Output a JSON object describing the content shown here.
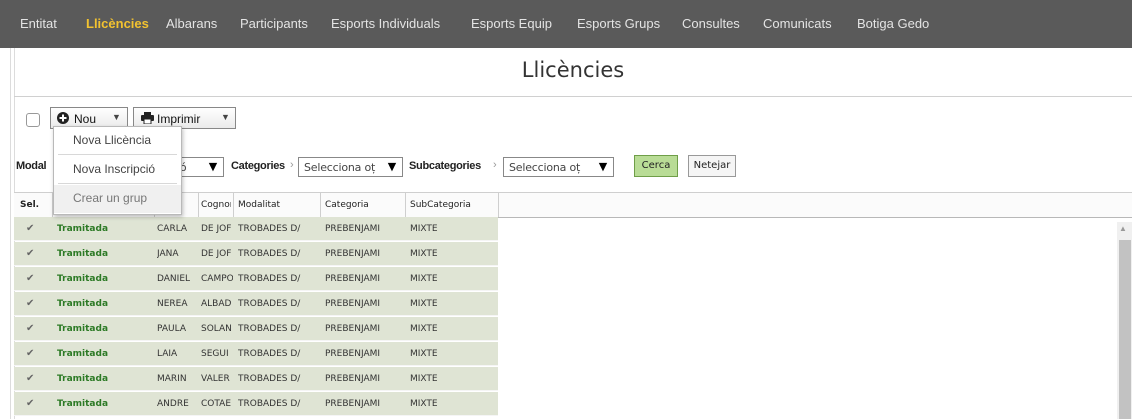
{
  "nav": {
    "items": [
      {
        "label": "Entitat",
        "active": false
      },
      {
        "label": "Llicències",
        "active": true
      },
      {
        "label": "Albarans",
        "active": false
      },
      {
        "label": "Participants",
        "active": false
      },
      {
        "label": "Esports Individuals",
        "active": false
      },
      {
        "label": "Esports Equip",
        "active": false
      },
      {
        "label": "Esports Grups",
        "active": false
      },
      {
        "label": "Consultes",
        "active": false
      },
      {
        "label": "Comunicats",
        "active": false
      },
      {
        "label": "Botiga Gedo",
        "active": false
      }
    ]
  },
  "page": {
    "title": "Llicències"
  },
  "toolbar": {
    "nou_label": "Nou",
    "imprimir_label": "Imprimir",
    "nou_icon": "plus-circle-icon",
    "imprimir_icon": "printer-icon"
  },
  "dropdown": {
    "items": [
      "Nova Llicència",
      "Nova Inscripció",
      "Crear un grup"
    ]
  },
  "filters": {
    "modalitat_label": "Modal",
    "modalitat_value": "ió",
    "categories_label": "Categories",
    "categories_value": "Selecciona oț",
    "subcategories_label": "Subcategories",
    "subcategories_value": "Selecciona oț",
    "search_button": "Cerca",
    "clear_button": "Netejar"
  },
  "grid": {
    "columns": [
      "Sel.",
      "",
      "",
      "Cognor",
      "Modalitat",
      "Categoria",
      "SubCategoria"
    ],
    "rows": [
      {
        "checked": true,
        "status": "Tramitada",
        "name": "CARLA",
        "surname": "DE JOF",
        "modalitat": "TROBADES D/",
        "categoria": "PREBENJAMÍ",
        "subcategoria": "MIXTE"
      },
      {
        "checked": true,
        "status": "Tramitada",
        "name": "JANA",
        "surname": "DE JOF",
        "modalitat": "TROBADES D/",
        "categoria": "PREBENJAMÍ",
        "subcategoria": "MIXTE"
      },
      {
        "checked": true,
        "status": "Tramitada",
        "name": "DANIEL",
        "surname": "CAMPO",
        "modalitat": "TROBADES D/",
        "categoria": "PREBENJAMÍ",
        "subcategoria": "MIXTE"
      },
      {
        "checked": true,
        "status": "Tramitada",
        "name": "NEREA",
        "surname": "ALBAD",
        "modalitat": "TROBADES D/",
        "categoria": "PREBENJAMÍ",
        "subcategoria": "MIXTE"
      },
      {
        "checked": true,
        "status": "Tramitada",
        "name": "PAULA",
        "surname": "SOLAN",
        "modalitat": "TROBADES D/",
        "categoria": "PREBENJAMÍ",
        "subcategoria": "MIXTE"
      },
      {
        "checked": true,
        "status": "Tramitada",
        "name": "LAIA",
        "surname": "SEGUI",
        "modalitat": "TROBADES D/",
        "categoria": "PREBENJAMÍ",
        "subcategoria": "MIXTE"
      },
      {
        "checked": true,
        "status": "Tramitada",
        "name": "MARIN",
        "surname": "VALER",
        "modalitat": "TROBADES D/",
        "categoria": "PREBENJAMÍ",
        "subcategoria": "MIXTE"
      },
      {
        "checked": true,
        "status": "Tramitada",
        "name": "ANDRE",
        "surname": "COTAE",
        "modalitat": "TROBADES D/",
        "categoria": "PREBENJAMÍ",
        "subcategoria": "MIXTE"
      }
    ]
  },
  "colors": {
    "nav_bg": "#5a5a5a",
    "nav_active": "#f2c230",
    "status_green": "#2c7a25",
    "row_bg": "#dfe4d4",
    "search_btn": "#b9dc96"
  }
}
